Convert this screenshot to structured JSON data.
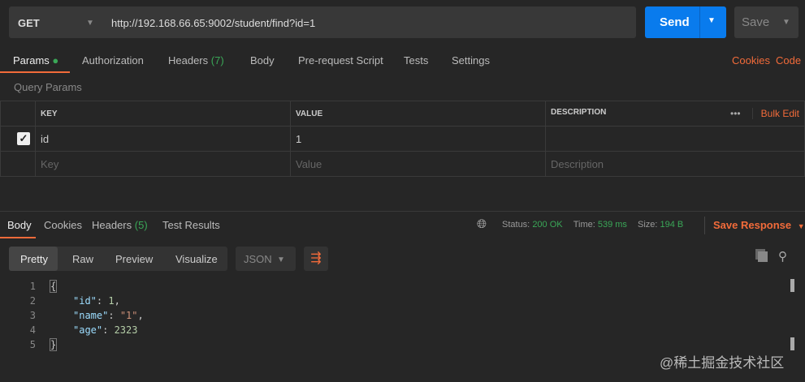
{
  "request": {
    "method": "GET",
    "url": "http://192.168.66.65:9002/student/find?id=1",
    "send_label": "Send",
    "save_label": "Save"
  },
  "request_tabs": [
    {
      "label": "Params"
    },
    {
      "label": "Authorization"
    },
    {
      "label": "Headers",
      "count": "(7)"
    },
    {
      "label": "Body"
    },
    {
      "label": "Pre-request Script"
    },
    {
      "label": "Tests"
    },
    {
      "label": "Settings"
    }
  ],
  "links": {
    "cookies": "Cookies",
    "code": "Code"
  },
  "query_params": {
    "title": "Query Params",
    "headers": [
      "KEY",
      "VALUE",
      "DESCRIPTION"
    ],
    "bulk_edit": "Bulk Edit",
    "more": "•••",
    "rows": [
      {
        "key": "id",
        "value": "1",
        "description": ""
      }
    ],
    "placeholder": {
      "key": "Key",
      "value": "Value",
      "description": "Description"
    }
  },
  "response_tabs": [
    {
      "label": "Body"
    },
    {
      "label": "Cookies"
    },
    {
      "label": "Headers",
      "count": "(5)"
    },
    {
      "label": "Test Results"
    }
  ],
  "status": {
    "status_label": "Status:",
    "status": "200 OK",
    "time_label": "Time:",
    "time": "539 ms",
    "size_label": "Size:",
    "size": "194 B",
    "save_response": "Save Response"
  },
  "view_modes": [
    "Pretty",
    "Raw",
    "Preview",
    "Visualize"
  ],
  "format": "JSON",
  "code_lines": [
    "1",
    "2",
    "3",
    "4",
    "5"
  ],
  "json": {
    "open": "{",
    "close": "}",
    "k1": "\"id\"",
    "v1": "1",
    "k2": "\"name\"",
    "v2": "\"1\"",
    "k3": "\"age\"",
    "v3": "2323"
  },
  "watermark": "@稀土掘金技术社区",
  "colors": {
    "accent": "#f26b3a",
    "send": "#097bed",
    "success": "#3aa757"
  }
}
